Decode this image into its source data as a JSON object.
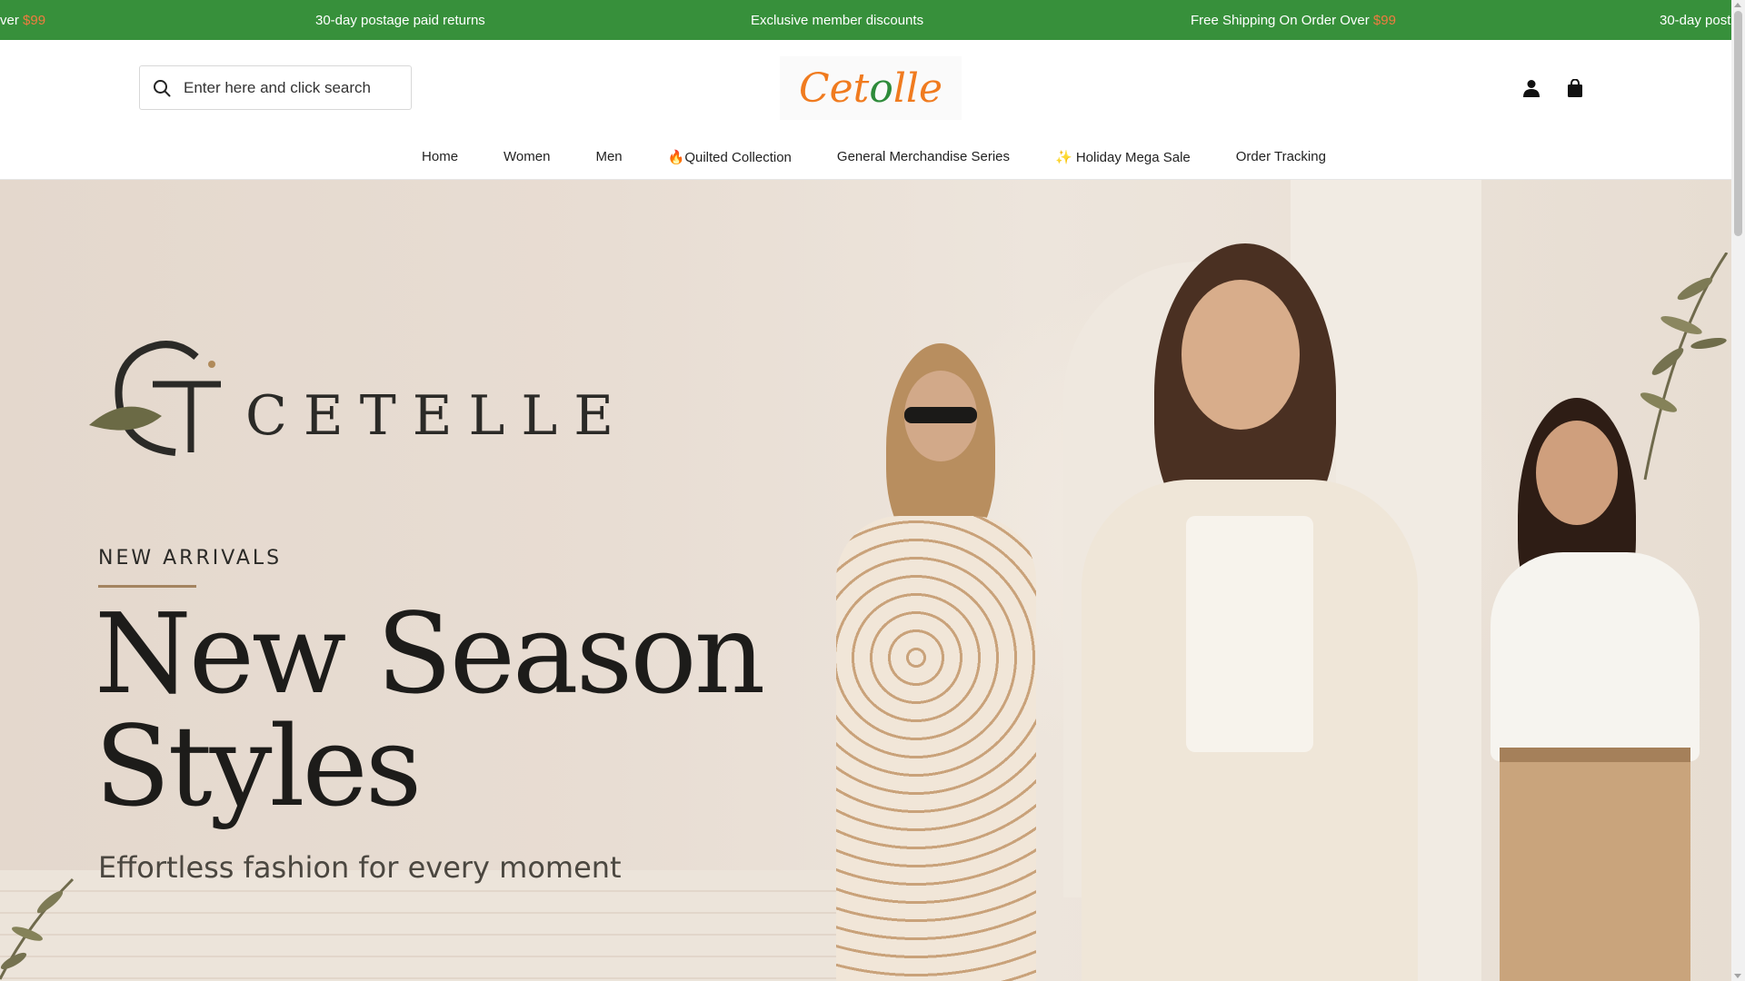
{
  "announcement": {
    "items": [
      {
        "text": "ver ",
        "amount": "$99"
      },
      {
        "text": "30-day postage paid returns"
      },
      {
        "text": "Exclusive member discounts"
      },
      {
        "text": "Free Shipping On Order Over ",
        "amount": "$99"
      },
      {
        "text": "30-day posta"
      }
    ],
    "color": "#37903b"
  },
  "header": {
    "search_placeholder": "Enter here and click search",
    "logo": {
      "part1": "Cet",
      "part2": "o",
      "part3": "lle"
    },
    "icons": {
      "search": "search-icon",
      "account": "user-icon",
      "cart": "shopping-bag-icon"
    }
  },
  "nav": {
    "items": [
      {
        "label": "Home"
      },
      {
        "label": "Women"
      },
      {
        "label": "Men"
      },
      {
        "label": "🔥Quilted Collection"
      },
      {
        "label": "General Merchandise Series"
      },
      {
        "label": "✨ Holiday Mega Sale"
      },
      {
        "label": "Order Tracking"
      }
    ]
  },
  "hero": {
    "brand": "CETELLE",
    "eyebrow": "NEW ARRIVALS",
    "headline_line1": "New Season",
    "headline_line2": "Styles",
    "tagline": "Effortless fashion for every moment"
  },
  "colors": {
    "accent": "#f07b3f",
    "brand_green": "#37903b"
  }
}
